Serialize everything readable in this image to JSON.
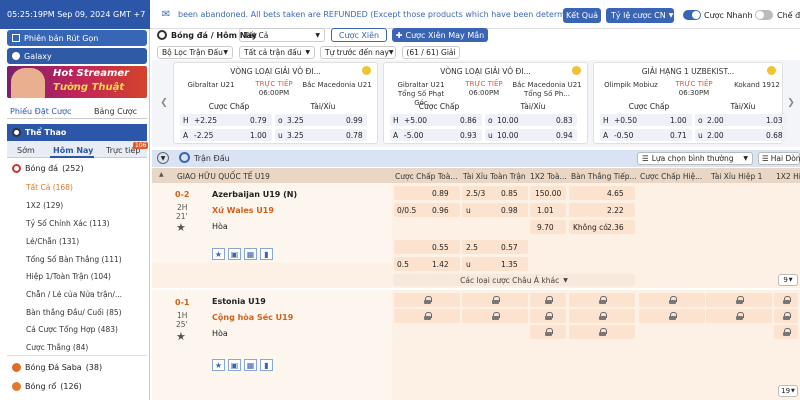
{
  "topbar": {
    "time": "05:25:19PM Sep 09, 2024 GMT +7",
    "ticker": "been abandoned. All bets taken are REFUNDED (Except those products which have been determined",
    "result_btn": "Kết Quả",
    "rate_btn": "Tỷ lệ cược CN",
    "fast_bet": "Cược Nhanh",
    "mode_toggle": "Chế đ"
  },
  "sidebar": {
    "banner1": "Phiên bản Rút Gọn",
    "banner2": "Galaxy",
    "promo_line1": "Hot Streamer",
    "promo_line2": "Tường Thuật",
    "tab_slip": "Phiếu Đặt Cược",
    "tab_board": "Bảng Cược",
    "sports_title": "Thể Thao",
    "time_tabs": [
      "Sớm",
      "Hôm Nay",
      "Trực tiếp"
    ],
    "live_badge": "106",
    "soccer": "Bóng đá",
    "soccer_count": "(252)",
    "items": [
      "Tất Cả (168)",
      "1X2 (129)",
      "Tỷ Số Chính Xác (113)",
      "Lẻ/Chẵn (131)",
      "Tổng Số Bàn Thắng (111)",
      "Hiệp 1/Toàn Trận (104)",
      "Chẵn / Lẻ của Nửa trận/...",
      "Bàn thắng Đầu/ Cuối (85)",
      "Cá Cược Tổng Hợp (483)",
      "Cược Thắng (84)"
    ],
    "saba": "Bóng Đá Saba",
    "saba_count": "(38)",
    "basket": "Bóng rổ",
    "basket_count": "(126)"
  },
  "header": {
    "crumb": "Bóng đá / Hôm Nay",
    "filter": "Tất Cả",
    "parlay_btn": "Cược Xiên",
    "mix_btn": "Cược Xiên May Mắn",
    "league_filter": "Bộ Lọc Trận Đấu",
    "bet_type": "Tất cả trận đấu",
    "sort": "Tự trước đến nay",
    "count": "(61 / 61) Giải"
  },
  "featured": [
    {
      "league": "VÒNG LOẠI GIẢI VÔ ĐI...",
      "home": "Gibraltar U21",
      "away": "Bắc Macedonia U21",
      "live": "TRỰC TIẾP",
      "time": "06:00PM",
      "h_line": "+2.25",
      "h_odd": "0.79",
      "o_line": "3.25",
      "o_odd": "0.99",
      "a_line": "-2.25",
      "a_odd": "1.00",
      "u_line": "3.25",
      "u_odd": "0.78"
    },
    {
      "league": "VÒNG LOẠI GIẢI VÔ ĐI...",
      "home": "Gibraltar U21 Tổng Số Phạt Góc",
      "away": "Bắc Macedonia U21 Tổng Số Ph...",
      "live": "TRỰC TIẾP",
      "time": "06:00PM",
      "h_line": "+5.00",
      "h_odd": "0.86",
      "o_line": "10.00",
      "o_odd": "0.83",
      "a_line": "-5.00",
      "a_odd": "0.93",
      "u_line": "10.00",
      "u_odd": "0.94"
    },
    {
      "league": "GIẢI HẠNG 1 UZBEKIST...",
      "home": "Olimpik Mobiuz",
      "away": "Kokand 1912",
      "live": "TRỰC TIẾP",
      "time": "06:30PM",
      "h_line": "+0.50",
      "h_odd": "1.00",
      "o_line": "2.00",
      "o_odd": "1.03",
      "a_line": "-0.50",
      "a_odd": "0.71",
      "u_line": "2.00",
      "u_odd": "0.68"
    }
  ],
  "featured_labels": {
    "hcap": "Cược Chấp",
    "ou": "Tài/Xỉu"
  },
  "matches_bar": {
    "title": "Trận Đấu",
    "sort_select": "Lựa chọn bình thường",
    "view_select": "Hai Dòng"
  },
  "table_headers": {
    "league": "GIAO HỮU QUỐC TẾ U19",
    "cols": [
      "Cược Chấp Toà...",
      "Tài Xỉu Toàn Trận",
      "1X2 Toà...",
      "Bàn Thắng Tiếp...",
      "Cược Chấp Hiệ...",
      "Tài Xỉu Hiệp 1",
      "1X2 Hiệp 1"
    ]
  },
  "match1": {
    "score": "0-2",
    "period": "2H",
    "minute": "21'",
    "home": "Azerbaijan U19 (N)",
    "away": "Xứ Wales U19",
    "draw": "Hòa",
    "r1": {
      "hc": "",
      "hc_odd": "0.89",
      "ou": "2.5/3",
      "ou_odd": "0.85",
      "x12": "150.00",
      "next": "4.65"
    },
    "r2": {
      "hc": "0/0.5",
      "hc_odd": "0.96",
      "ou": "u",
      "ou_odd": "0.98",
      "x12": "1.01",
      "next": "2.22"
    },
    "r3": {
      "x12": "9.70",
      "next_label": "Không có",
      "next": "2.36"
    },
    "r4": {
      "hc_odd": "0.55",
      "ou": "2.5",
      "ou_odd": "0.57"
    },
    "r5": {
      "hc": "0.5",
      "hc_odd": "1.42",
      "ou": "u",
      "ou_odd": "1.35"
    },
    "more": "Các loại cược Châu Á khác",
    "count": "9"
  },
  "match2": {
    "score": "0-1",
    "period": "1H",
    "minute": "25'",
    "home": "Estonia U19",
    "away": "Cộng hòa Séc U19",
    "draw": "Hòa",
    "count": "19"
  }
}
